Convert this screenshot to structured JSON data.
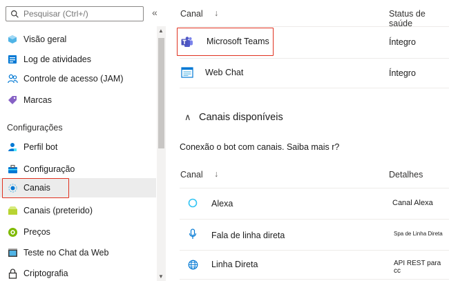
{
  "sidebar": {
    "search_placeholder": "Pesquisar (Ctrl+/)",
    "collapse_glyph": "«",
    "items_top": [
      {
        "label": "Visão geral",
        "icon": "cloud-icon"
      },
      {
        "label": "Log de atividades",
        "icon": "log-icon"
      },
      {
        "label": "Controle de acesso (JAM)",
        "icon": "people-icon"
      },
      {
        "label": "Marcas",
        "icon": "tag-icon"
      }
    ],
    "section_label": "Configurações",
    "items_config": [
      {
        "label": "Perfil bot",
        "icon": "bot-profile-icon"
      },
      {
        "label": "Configuração",
        "icon": "toolbox-icon"
      },
      {
        "label": "Canais",
        "icon": "channels-icon"
      },
      {
        "label": "Canais (preterido)",
        "icon": "channels-legacy-icon"
      },
      {
        "label": "Preços",
        "icon": "pricing-icon"
      },
      {
        "label": "Teste no Chat da Web",
        "icon": "webchat-test-icon"
      },
      {
        "label": "Criptografia",
        "icon": "lock-icon"
      }
    ]
  },
  "main": {
    "table1": {
      "col_channel": "Canal",
      "sort_glyph": "↓",
      "col_status": "Status de saúde",
      "rows": [
        {
          "name": "Microsoft Teams",
          "status": "Íntegro",
          "icon": "teams-icon"
        },
        {
          "name": "Web Chat",
          "status": "Íntegro",
          "icon": "webchat-icon"
        }
      ]
    },
    "available": {
      "chevron": "∧",
      "title": "Canais disponíveis",
      "description": "Conexão o bot com canais. Saiba mais r?"
    },
    "table2": {
      "col_channel": "Canal",
      "sort_glyph": "↓",
      "col_details": "Detalhes",
      "rows": [
        {
          "name": "Alexa",
          "detail": "Canal Alexa",
          "icon": "alexa-icon"
        },
        {
          "name": "Fala de linha direta",
          "detail": "Spa de Linha Direta",
          "icon": "microphone-icon"
        },
        {
          "name": "Linha Direta",
          "detail": "API REST para cc",
          "icon": "globe-icon"
        }
      ]
    }
  },
  "colors": {
    "highlight": "#e0301e",
    "selected_bg": "#ececec",
    "teams_purple": "#5059c9",
    "azure_blue": "#0078d4"
  }
}
